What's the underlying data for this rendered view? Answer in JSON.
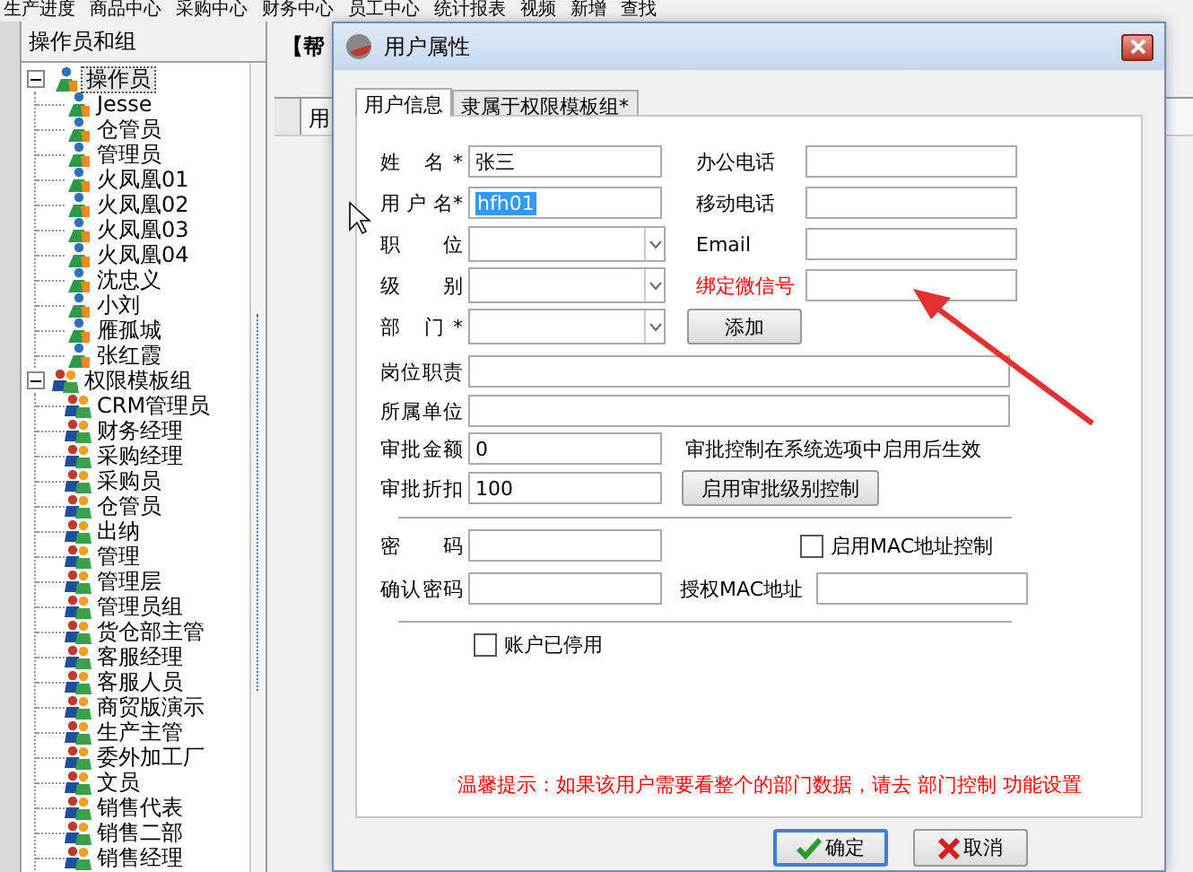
{
  "menu_bar": {
    "items": [
      "生产进度",
      "商品中心",
      "采购中心",
      "财务中心",
      "员工中心",
      "统计报表",
      "视频",
      "新增",
      "查找"
    ]
  },
  "sidebar": {
    "title": "操作员和组",
    "tree": [
      {
        "label": "操作员",
        "kind": "user",
        "selected": true,
        "expanded": true,
        "children": [
          {
            "label": "Jesse",
            "kind": "user",
            "selected": false
          },
          {
            "label": "仓管员",
            "kind": "user",
            "selected": false
          },
          {
            "label": "管理员",
            "kind": "user",
            "selected": false
          },
          {
            "label": "火凤凰01",
            "kind": "user",
            "selected": false
          },
          {
            "label": "火凤凰02",
            "kind": "user",
            "selected": false
          },
          {
            "label": "火凤凰03",
            "kind": "user",
            "selected": false
          },
          {
            "label": "火凤凰04",
            "kind": "user",
            "selected": false
          },
          {
            "label": "沈忠义",
            "kind": "user",
            "selected": false
          },
          {
            "label": "小刘",
            "kind": "user",
            "selected": false
          },
          {
            "label": "雁孤城",
            "kind": "user",
            "selected": false
          },
          {
            "label": "张红霞",
            "kind": "user",
            "selected": false
          }
        ]
      },
      {
        "label": "权限模板组",
        "kind": "group",
        "selected": false,
        "expanded": true,
        "children": [
          {
            "label": "CRM管理员",
            "kind": "group",
            "selected": false
          },
          {
            "label": "财务经理",
            "kind": "group",
            "selected": false
          },
          {
            "label": "采购经理",
            "kind": "group",
            "selected": false
          },
          {
            "label": "采购员",
            "kind": "group",
            "selected": false
          },
          {
            "label": "仓管员",
            "kind": "group",
            "selected": false
          },
          {
            "label": "出纳",
            "kind": "group",
            "selected": false
          },
          {
            "label": "管理",
            "kind": "group",
            "selected": false
          },
          {
            "label": "管理层",
            "kind": "group",
            "selected": false
          },
          {
            "label": "管理员组",
            "kind": "group",
            "selected": false
          },
          {
            "label": "货仓部主管",
            "kind": "group",
            "selected": false
          },
          {
            "label": "客服经理",
            "kind": "group",
            "selected": false
          },
          {
            "label": "客服人员",
            "kind": "group",
            "selected": false
          },
          {
            "label": "商贸版演示",
            "kind": "group",
            "selected": false
          },
          {
            "label": "生产主管",
            "kind": "group",
            "selected": false
          },
          {
            "label": "委外加工厂",
            "kind": "group",
            "selected": false
          },
          {
            "label": "文员",
            "kind": "group",
            "selected": false
          },
          {
            "label": "销售代表",
            "kind": "group",
            "selected": false
          },
          {
            "label": "销售二部",
            "kind": "group",
            "selected": false
          },
          {
            "label": "销售经理",
            "kind": "group",
            "selected": false
          }
        ]
      }
    ]
  },
  "background": {
    "tab": "【帮",
    "grid_header": "用"
  },
  "dialog": {
    "title": "用户属性",
    "tabs": [
      {
        "label": "用户信息",
        "selected": true
      },
      {
        "label": "隶属于权限模板组*",
        "selected": false
      }
    ],
    "left_fields": [
      {
        "label": "姓 名*",
        "kind": "text",
        "value": "张三",
        "highlighted": false
      },
      {
        "label": "用 户 名*",
        "kind": "text",
        "value": "hfh01",
        "highlighted": true
      },
      {
        "label": "职 位",
        "kind": "select"
      },
      {
        "label": "级 别",
        "kind": "select"
      },
      {
        "label": "部 门*",
        "kind": "select"
      }
    ],
    "right_fields": [
      {
        "label": "办公电话",
        "kind": "text",
        "color": "#000000"
      },
      {
        "label": "移动电话",
        "kind": "text",
        "color": "#000000"
      },
      {
        "label": "Email",
        "kind": "text",
        "color": "#000000"
      },
      {
        "label": "绑定微信号",
        "kind": "text",
        "color": "#ff0000"
      },
      {
        "label": "添加",
        "kind": "button"
      }
    ],
    "wide_fields": [
      {
        "label": "岗位职责"
      },
      {
        "label": "所属单位"
      }
    ],
    "approval": {
      "amount_label": "审批金额",
      "amount": "0",
      "note": "审批控制在系统选项中启用后生效",
      "discount_label": "审批折扣",
      "discount": "100",
      "button": "启用审批级别控制"
    },
    "password": {
      "label": "密 码",
      "confirm_label": "确认密码",
      "mac_checkbox": {
        "label": "启用MAC地址控制",
        "checked": false
      },
      "mac_label": "授权MAC地址"
    },
    "disabled_checkbox": {
      "label": "账户已停用",
      "checked": false
    },
    "tip": "温馨提示：如果该用户需要看整个的部门数据，请去 部门控制 功能设置",
    "buttons": [
      {
        "label": "确定",
        "kind": "ok",
        "default": true
      },
      {
        "label": "取消",
        "kind": "cancel",
        "default": false
      }
    ]
  }
}
